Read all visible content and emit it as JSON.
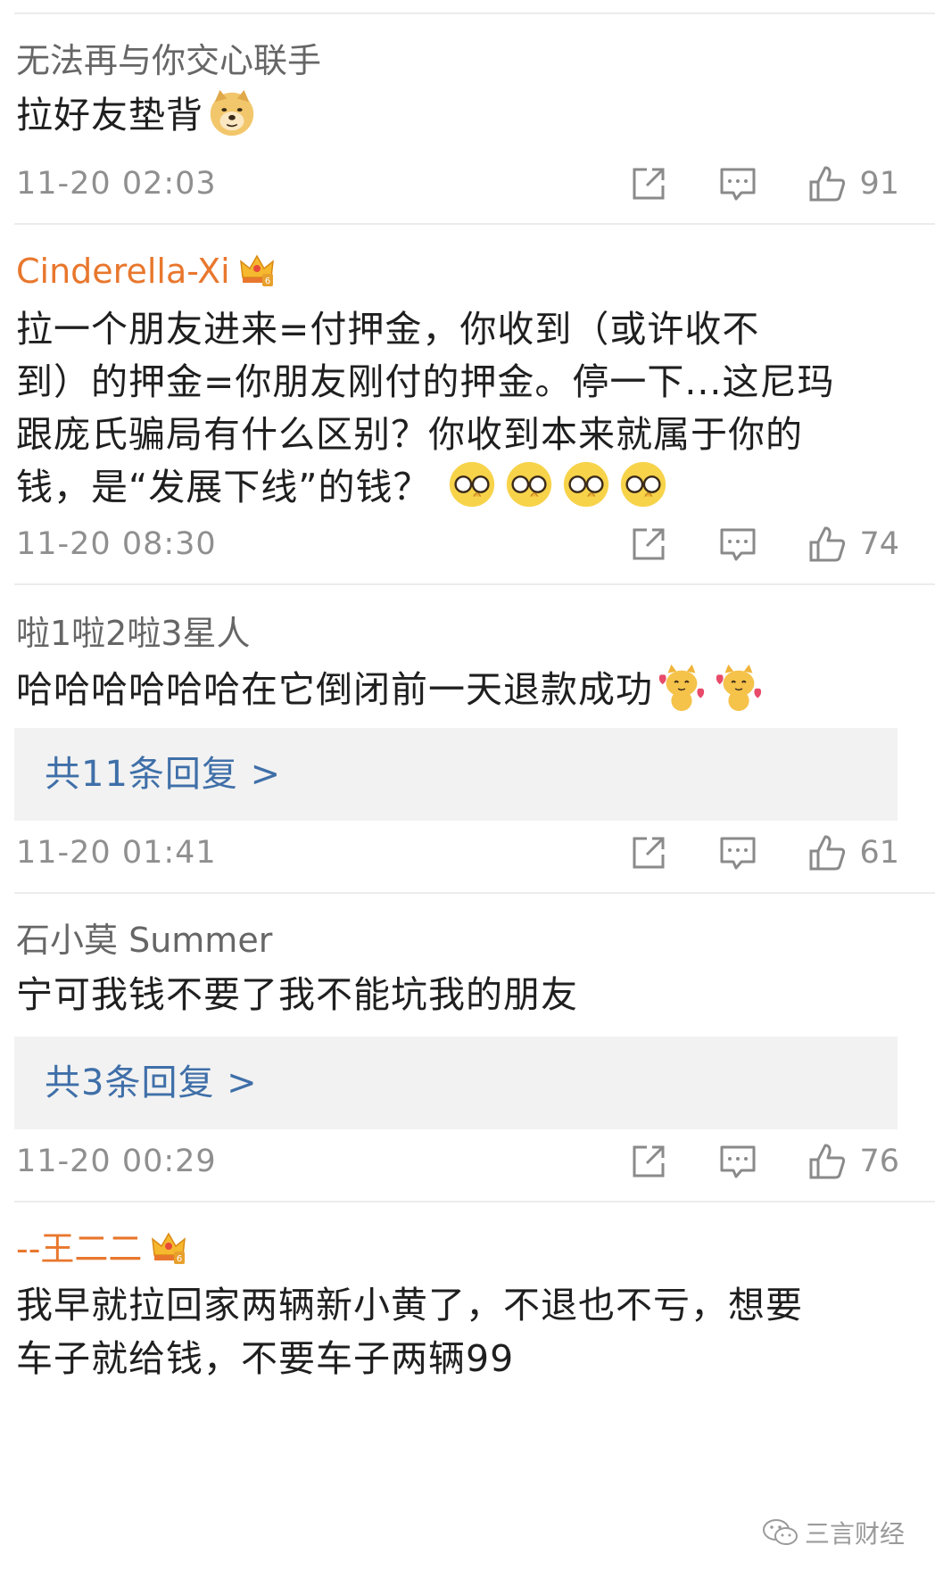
{
  "comments": [
    {
      "username": "无法再与你交心联手",
      "text": "拉好友垫背",
      "time": "11-20 02:03",
      "likes": "91",
      "emoji": [
        "doge-emoji"
      ]
    },
    {
      "username": "Cinderella-Xi",
      "text_lines": [
        "拉一个朋友进来=付押金，你收到（或许收不",
        "到）的押金=你朋友刚付的押金。停一下...这尼玛",
        "跟庞氏骗局有什么区别？你收到本来就属于你的",
        "钱，是“发展下线”的钱？"
      ],
      "time": "11-20 08:30",
      "likes": "74",
      "emoji": [
        "glasses-emoji",
        "glasses-emoji",
        "glasses-emoji",
        "glasses-emoji"
      ]
    },
    {
      "username": "啦1啦2啦3星人",
      "text": "哈哈哈哈哈哈在它倒闭前一天退款成功",
      "reply": "共11条回复 >",
      "time": "11-20 01:41",
      "likes": "61",
      "emoji": [
        "heart-cat-emoji",
        "heart-cat-emoji"
      ]
    },
    {
      "username": "石小莫 Summer",
      "text": "宁可我钱不要了我不能坑我的朋友",
      "reply": "共3条回复 >",
      "time": "11-20 00:29",
      "likes": "76"
    },
    {
      "username": "--王二二",
      "text_lines": [
        "我早就拉回家两辆新小黄了，不退也不亏，想要",
        "车子就给钱，不要车子两辆99"
      ]
    }
  ],
  "watermark": "三言财经",
  "icons": {
    "share": "share-icon",
    "comment": "comment-icon",
    "like": "thumbs-up-icon",
    "vip": "crown-badge-icon"
  },
  "colors": {
    "vip_name": "#e8772d",
    "reply_link": "#3f6fa8",
    "meta": "#8f8f8f"
  }
}
